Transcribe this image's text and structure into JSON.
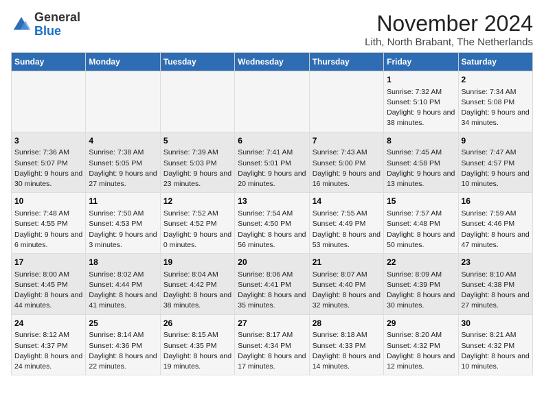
{
  "logo": {
    "general": "General",
    "blue": "Blue"
  },
  "header": {
    "month": "November 2024",
    "location": "Lith, North Brabant, The Netherlands"
  },
  "days_of_week": [
    "Sunday",
    "Monday",
    "Tuesday",
    "Wednesday",
    "Thursday",
    "Friday",
    "Saturday"
  ],
  "weeks": [
    [
      {
        "day": "",
        "info": ""
      },
      {
        "day": "",
        "info": ""
      },
      {
        "day": "",
        "info": ""
      },
      {
        "day": "",
        "info": ""
      },
      {
        "day": "",
        "info": ""
      },
      {
        "day": "1",
        "info": "Sunrise: 7:32 AM\nSunset: 5:10 PM\nDaylight: 9 hours and 38 minutes."
      },
      {
        "day": "2",
        "info": "Sunrise: 7:34 AM\nSunset: 5:08 PM\nDaylight: 9 hours and 34 minutes."
      }
    ],
    [
      {
        "day": "3",
        "info": "Sunrise: 7:36 AM\nSunset: 5:07 PM\nDaylight: 9 hours and 30 minutes."
      },
      {
        "day": "4",
        "info": "Sunrise: 7:38 AM\nSunset: 5:05 PM\nDaylight: 9 hours and 27 minutes."
      },
      {
        "day": "5",
        "info": "Sunrise: 7:39 AM\nSunset: 5:03 PM\nDaylight: 9 hours and 23 minutes."
      },
      {
        "day": "6",
        "info": "Sunrise: 7:41 AM\nSunset: 5:01 PM\nDaylight: 9 hours and 20 minutes."
      },
      {
        "day": "7",
        "info": "Sunrise: 7:43 AM\nSunset: 5:00 PM\nDaylight: 9 hours and 16 minutes."
      },
      {
        "day": "8",
        "info": "Sunrise: 7:45 AM\nSunset: 4:58 PM\nDaylight: 9 hours and 13 minutes."
      },
      {
        "day": "9",
        "info": "Sunrise: 7:47 AM\nSunset: 4:57 PM\nDaylight: 9 hours and 10 minutes."
      }
    ],
    [
      {
        "day": "10",
        "info": "Sunrise: 7:48 AM\nSunset: 4:55 PM\nDaylight: 9 hours and 6 minutes."
      },
      {
        "day": "11",
        "info": "Sunrise: 7:50 AM\nSunset: 4:53 PM\nDaylight: 9 hours and 3 minutes."
      },
      {
        "day": "12",
        "info": "Sunrise: 7:52 AM\nSunset: 4:52 PM\nDaylight: 9 hours and 0 minutes."
      },
      {
        "day": "13",
        "info": "Sunrise: 7:54 AM\nSunset: 4:50 PM\nDaylight: 8 hours and 56 minutes."
      },
      {
        "day": "14",
        "info": "Sunrise: 7:55 AM\nSunset: 4:49 PM\nDaylight: 8 hours and 53 minutes."
      },
      {
        "day": "15",
        "info": "Sunrise: 7:57 AM\nSunset: 4:48 PM\nDaylight: 8 hours and 50 minutes."
      },
      {
        "day": "16",
        "info": "Sunrise: 7:59 AM\nSunset: 4:46 PM\nDaylight: 8 hours and 47 minutes."
      }
    ],
    [
      {
        "day": "17",
        "info": "Sunrise: 8:00 AM\nSunset: 4:45 PM\nDaylight: 8 hours and 44 minutes."
      },
      {
        "day": "18",
        "info": "Sunrise: 8:02 AM\nSunset: 4:44 PM\nDaylight: 8 hours and 41 minutes."
      },
      {
        "day": "19",
        "info": "Sunrise: 8:04 AM\nSunset: 4:42 PM\nDaylight: 8 hours and 38 minutes."
      },
      {
        "day": "20",
        "info": "Sunrise: 8:06 AM\nSunset: 4:41 PM\nDaylight: 8 hours and 35 minutes."
      },
      {
        "day": "21",
        "info": "Sunrise: 8:07 AM\nSunset: 4:40 PM\nDaylight: 8 hours and 32 minutes."
      },
      {
        "day": "22",
        "info": "Sunrise: 8:09 AM\nSunset: 4:39 PM\nDaylight: 8 hours and 30 minutes."
      },
      {
        "day": "23",
        "info": "Sunrise: 8:10 AM\nSunset: 4:38 PM\nDaylight: 8 hours and 27 minutes."
      }
    ],
    [
      {
        "day": "24",
        "info": "Sunrise: 8:12 AM\nSunset: 4:37 PM\nDaylight: 8 hours and 24 minutes."
      },
      {
        "day": "25",
        "info": "Sunrise: 8:14 AM\nSunset: 4:36 PM\nDaylight: 8 hours and 22 minutes."
      },
      {
        "day": "26",
        "info": "Sunrise: 8:15 AM\nSunset: 4:35 PM\nDaylight: 8 hours and 19 minutes."
      },
      {
        "day": "27",
        "info": "Sunrise: 8:17 AM\nSunset: 4:34 PM\nDaylight: 8 hours and 17 minutes."
      },
      {
        "day": "28",
        "info": "Sunrise: 8:18 AM\nSunset: 4:33 PM\nDaylight: 8 hours and 14 minutes."
      },
      {
        "day": "29",
        "info": "Sunrise: 8:20 AM\nSunset: 4:32 PM\nDaylight: 8 hours and 12 minutes."
      },
      {
        "day": "30",
        "info": "Sunrise: 8:21 AM\nSunset: 4:32 PM\nDaylight: 8 hours and 10 minutes."
      }
    ]
  ]
}
